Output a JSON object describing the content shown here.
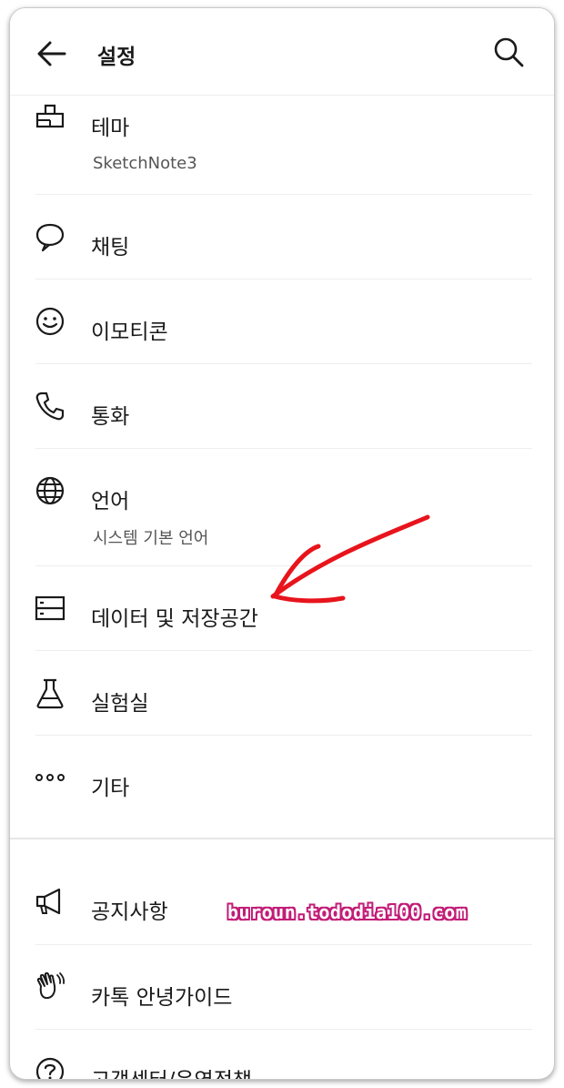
{
  "header": {
    "title": "설정"
  },
  "items": [
    {
      "label": "테마",
      "sub": "SketchNote3",
      "icon": "paint-brush-icon"
    },
    {
      "label": "채팅",
      "icon": "chat-bubble-icon"
    },
    {
      "label": "이모티콘",
      "icon": "smiley-icon"
    },
    {
      "label": "통화",
      "icon": "phone-icon"
    },
    {
      "label": "언어",
      "sub": "시스템 기본 언어",
      "icon": "globe-icon"
    },
    {
      "label": "데이터 및 저장공간",
      "icon": "storage-icon"
    },
    {
      "label": "실험실",
      "icon": "flask-icon"
    },
    {
      "label": "기타",
      "icon": "more-dots-icon"
    }
  ],
  "items2": [
    {
      "label": "공지사항",
      "icon": "megaphone-icon"
    },
    {
      "label": "카톡 안녕가이드",
      "icon": "waving-hand-icon"
    },
    {
      "label": "고객센터/운영정책",
      "icon": "help-circle-icon"
    }
  ],
  "watermark": "buroun.tododia100.com",
  "colors": {
    "annotation": "#e8141c",
    "watermark_outline": "#c21d77"
  }
}
